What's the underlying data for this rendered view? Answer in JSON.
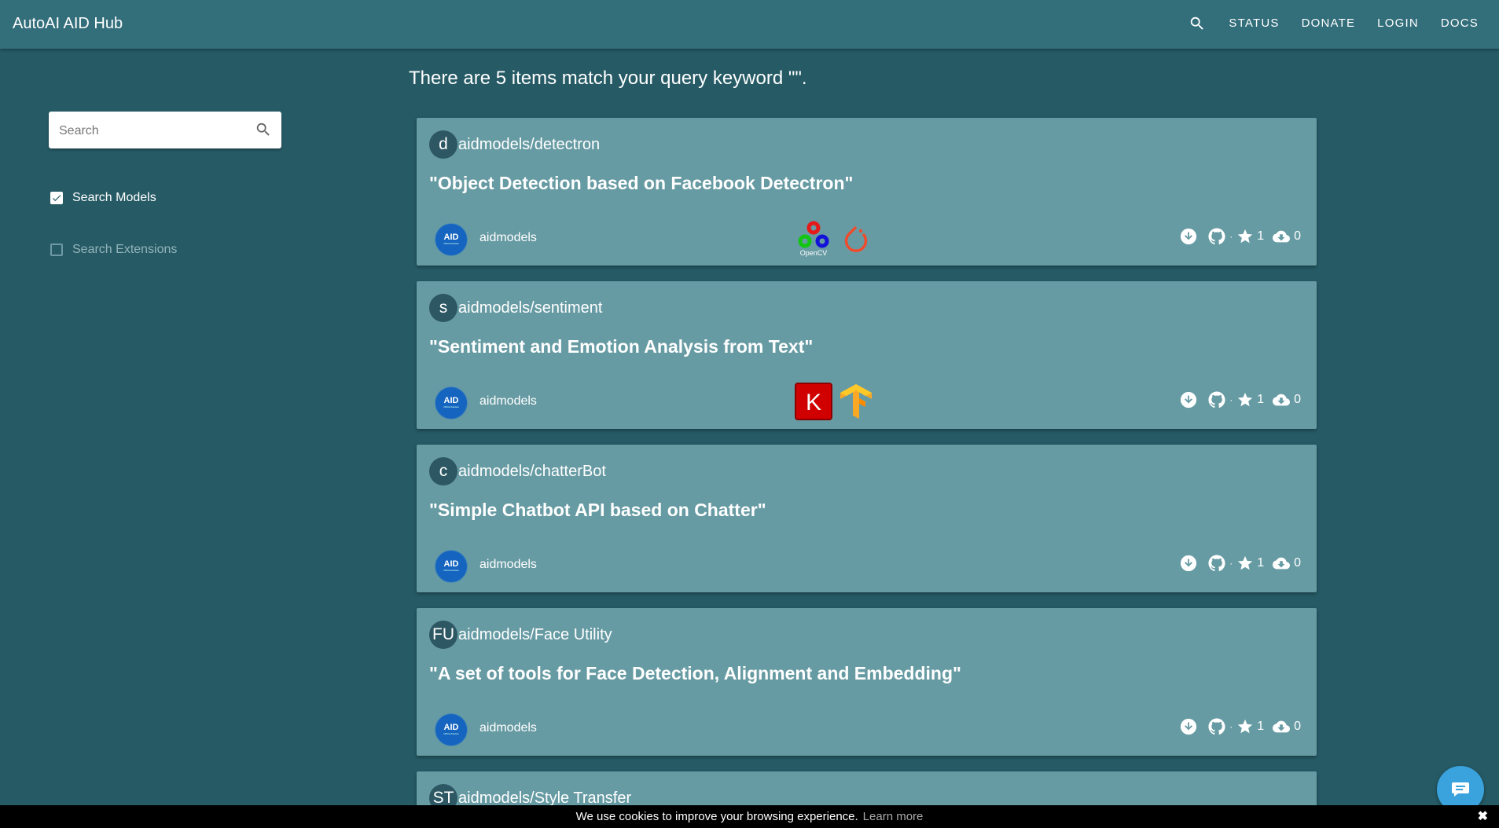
{
  "app": {
    "title": "AutoAI AID Hub"
  },
  "nav": {
    "search_icon": "search-icon",
    "links": [
      "STATUS",
      "DONATE",
      "LOGIN",
      "DOCS"
    ]
  },
  "sidebar": {
    "search": {
      "placeholder": "Search",
      "value": ""
    },
    "filters": [
      {
        "label": "Search Models",
        "checked": true
      },
      {
        "label": "Search Extensions",
        "checked": false
      }
    ]
  },
  "results": {
    "summary": "There are 5 items match your query keyword \"\".",
    "items": [
      {
        "initials": "d",
        "name": "aidmodels/detectron",
        "description": "\"Object Detection based on Facebook Detectron\"",
        "org": "aidmodels",
        "org_avatar": {
          "line1": "AID",
          "line2": "Official Models"
        },
        "frameworks": [
          {
            "icon": "opencv-logo",
            "label": "OpenCV"
          },
          {
            "icon": "pytorch-logo"
          }
        ],
        "stars": "1",
        "downloads": "0"
      },
      {
        "initials": "s",
        "name": "aidmodels/sentiment",
        "description": "\"Sentiment and Emotion Analysis from Text\"",
        "org": "aidmodels",
        "org_avatar": {
          "line1": "AID",
          "line2": "Official Models"
        },
        "frameworks": [
          {
            "icon": "keras-logo",
            "label": "K"
          },
          {
            "icon": "tensorflow-logo"
          }
        ],
        "stars": "1",
        "downloads": "0"
      },
      {
        "initials": "c",
        "name": "aidmodels/chatterBot",
        "description": "\"Simple Chatbot API based on Chatter\"",
        "org": "aidmodels",
        "org_avatar": {
          "line1": "AID",
          "line2": "Official Models"
        },
        "frameworks": [],
        "stars": "1",
        "downloads": "0"
      },
      {
        "initials": "FU",
        "name": "aidmodels/Face Utility",
        "description": "\"A set of tools for Face Detection, Alignment and Embedding\"",
        "org": "aidmodels",
        "org_avatar": {
          "line1": "AID",
          "line2": "Official Models"
        },
        "frameworks": [],
        "stars": "1",
        "downloads": "0"
      },
      {
        "initials": "ST",
        "name": "aidmodels/Style Transfer"
      }
    ]
  },
  "cookie_banner": {
    "text": "We use cookies to improve your browsing experience.",
    "link": "Learn more",
    "close": "✖"
  },
  "chat": {
    "icon": "chat-bubble-icon"
  },
  "colors": {
    "page_bg": "#265b66",
    "topbar": "#336e7b",
    "card": "#679ba3",
    "avatar_letter": "#2c5763",
    "org_avatar": "#1565c0",
    "chat_button": "#3aa2dc"
  }
}
